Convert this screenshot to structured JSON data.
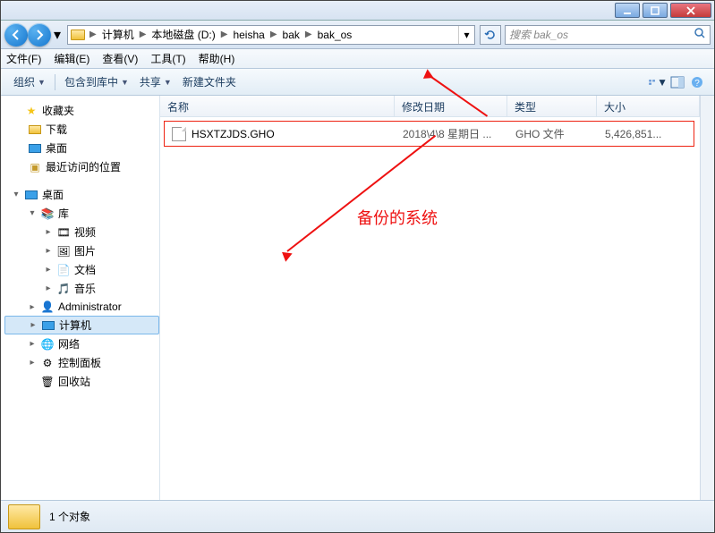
{
  "titlebar": {},
  "nav": {
    "crumbs": [
      "计算机",
      "本地磁盘 (D:)",
      "heisha",
      "bak",
      "bak_os"
    ],
    "search_placeholder": "搜索 bak_os"
  },
  "menu": {
    "file": "文件(F)",
    "edit": "编辑(E)",
    "view": "查看(V)",
    "tools": "工具(T)",
    "help": "帮助(H)"
  },
  "toolbar": {
    "organize": "组织",
    "include": "包含到库中",
    "share": "共享",
    "newfolder": "新建文件夹"
  },
  "tree": {
    "favorites": "收藏夹",
    "downloads": "下载",
    "desktop": "桌面",
    "recent": "最近访问的位置",
    "desktop_root": "桌面",
    "libraries": "库",
    "videos": "视频",
    "pictures": "图片",
    "documents": "文档",
    "music": "音乐",
    "admin": "Administrator",
    "computer": "计算机",
    "network": "网络",
    "control": "控制面板",
    "recycle": "回收站"
  },
  "columns": {
    "name": "名称",
    "date": "修改日期",
    "type": "类型",
    "size": "大小"
  },
  "files": [
    {
      "name": "HSXTZJDS.GHO",
      "date": "2018\\4\\8 星期日 ...",
      "type": "GHO 文件",
      "size": "5,426,851..."
    }
  ],
  "annotation": {
    "label": "备份的系统"
  },
  "status": {
    "count": "1 个对象"
  }
}
